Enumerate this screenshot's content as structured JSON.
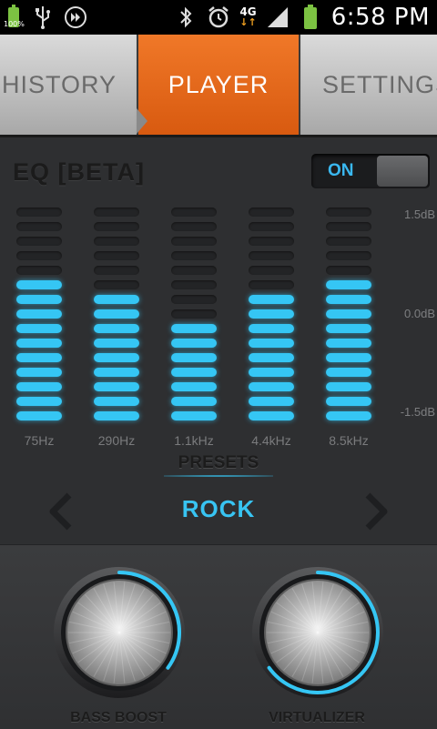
{
  "status_bar": {
    "battery_small_pct": "100%",
    "time": "6:58 PM",
    "network": "4G",
    "icons": [
      "battery-full-icon",
      "usb-icon",
      "media-play-icon",
      "bluetooth-icon",
      "alarm-clock-icon",
      "signal-strength-icon",
      "battery-icon"
    ]
  },
  "tabs": [
    {
      "label": "HISTORY",
      "active": false
    },
    {
      "label": "PLAYER",
      "active": true
    },
    {
      "label": "SETTINGS",
      "active": false
    }
  ],
  "eq": {
    "title": "EQ [BETA]",
    "toggle_label": "ON",
    "toggle_on": true,
    "db_labels": {
      "top": "1.5dB",
      "mid": "0.0dB",
      "bottom": "-1.5dB"
    },
    "segments_per_band": 15,
    "bands": [
      {
        "freq": "75Hz",
        "lit_segments": 10
      },
      {
        "freq": "290Hz",
        "lit_segments": 9
      },
      {
        "freq": "1.1kHz",
        "lit_segments": 7
      },
      {
        "freq": "4.4kHz",
        "lit_segments": 9
      },
      {
        "freq": "8.5kHz",
        "lit_segments": 10
      }
    ]
  },
  "presets": {
    "title": "PRESETS",
    "current": "ROCK"
  },
  "knobs": {
    "bass_boost": {
      "label": "BASS BOOST",
      "level": 0.35
    },
    "virtualizer": {
      "label": "VIRTUALIZER",
      "level": 0.65
    }
  },
  "colors": {
    "accent_blue": "#35c6f4",
    "tab_active": "#e8671b",
    "battery_green": "#7cc242"
  }
}
